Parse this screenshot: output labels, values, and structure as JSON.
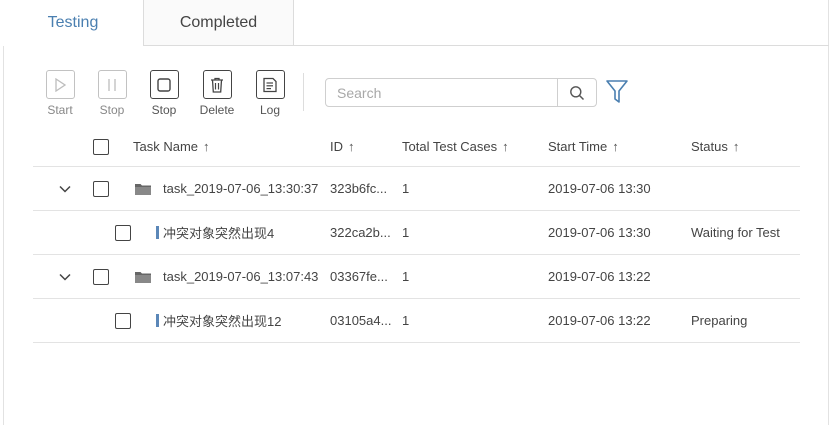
{
  "tabs": [
    {
      "label": "Testing",
      "active": true
    },
    {
      "label": "Completed",
      "active": false
    }
  ],
  "toolbar": {
    "start": "Start",
    "stop_disabled": "Stop",
    "stop": "Stop",
    "delete": "Delete",
    "log": "Log"
  },
  "search": {
    "placeholder": "Search",
    "value": ""
  },
  "table": {
    "headers": {
      "task_name": "Task Name",
      "id": "ID",
      "total": "Total Test Cases",
      "start_time": "Start Time",
      "status": "Status",
      "sort_arrow": "↑"
    },
    "rows": [
      {
        "name": "task_2019-07-06_13:30:37",
        "id": "323b6fc...",
        "total": "1",
        "start": "2019-07-06 13:30",
        "status": ""
      },
      {
        "name": "冲突对象突然出现4",
        "id": "322ca2b...",
        "total": "1",
        "start": "2019-07-06 13:30",
        "status": "Waiting for Test"
      },
      {
        "name": "task_2019-07-06_13:07:43",
        "id": "03367fe...",
        "total": "1",
        "start": "2019-07-06 13:22",
        "status": ""
      },
      {
        "name": "冲突对象突然出现12",
        "id": "03105a4...",
        "total": "1",
        "start": "2019-07-06 13:22",
        "status": "Preparing"
      }
    ]
  },
  "colors": {
    "accent": "#4a7fb0",
    "child_marker": "#5b87b8",
    "icon": "#444444"
  }
}
